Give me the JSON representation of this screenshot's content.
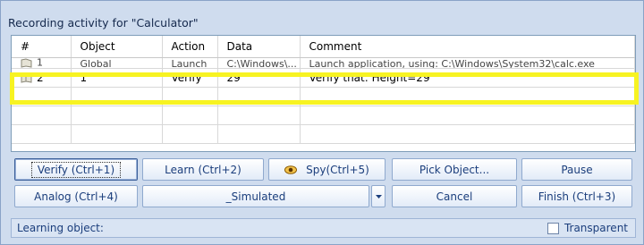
{
  "window": {
    "title": "Recording activity for \"Calculator\""
  },
  "grid": {
    "columns": [
      "#",
      "Object",
      "Action",
      "Data",
      "Comment"
    ],
    "rows": [
      {
        "num": "1",
        "object": "Global",
        "action": "Launch",
        "data": "C:\\Windows\\...",
        "comment": "Launch application, using: C:\\Windows\\System32\\calc.exe",
        "partial": true
      },
      {
        "num": "2",
        "object": "1",
        "action": "Verify",
        "data": "29",
        "comment": "Verify that: Height=29",
        "partial": false
      }
    ]
  },
  "buttons": {
    "verify": "Verify (Ctrl+1)",
    "learn": "Learn (Ctrl+2)",
    "spy": "Spy(Ctrl+5)",
    "pick": "Pick Object...",
    "pause": "Pause",
    "analog": "Analog (Ctrl+4)",
    "simulated": "_Simulated",
    "cancel": "Cancel",
    "finish": "Finish (Ctrl+3)"
  },
  "status": {
    "label": "Learning object:",
    "transparent_label": "Transparent",
    "transparent_checked": false
  },
  "colors": {
    "highlight": "#f7f322",
    "accent": "#1b3e7c"
  }
}
